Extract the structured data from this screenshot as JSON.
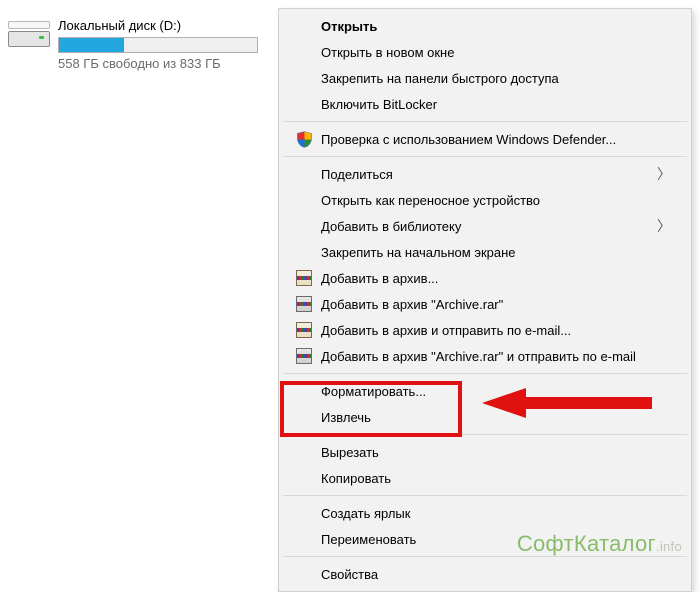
{
  "drive": {
    "name": "Локальный диск (D:)",
    "capacity_label": "558 ГБ свободно из 833 ГБ",
    "fill_percent": 33
  },
  "menu": {
    "items": [
      {
        "label": "Открыть",
        "bold": true
      },
      {
        "label": "Открыть в новом окне"
      },
      {
        "label": "Закрепить на панели быстрого доступа"
      },
      {
        "label": "Включить BitLocker"
      },
      {
        "sep": true
      },
      {
        "label": "Проверка с использованием Windows Defender...",
        "icon": "shield"
      },
      {
        "sep": true
      },
      {
        "label": "Поделиться",
        "submenu": true
      },
      {
        "label": "Открыть как переносное устройство"
      },
      {
        "label": "Добавить в библиотеку",
        "submenu": true
      },
      {
        "label": "Закрепить на начальном экране"
      },
      {
        "label": "Добавить в архив...",
        "icon": "rar"
      },
      {
        "label": "Добавить в архив \"Archive.rar\"",
        "icon": "rar2"
      },
      {
        "label": "Добавить в архив и отправить по e-mail...",
        "icon": "rar"
      },
      {
        "label": "Добавить в архив \"Archive.rar\" и отправить по e-mail",
        "icon": "rar2"
      },
      {
        "sep": true
      },
      {
        "label": "Форматировать...",
        "highlight": true
      },
      {
        "label": "Извлечь"
      },
      {
        "sep": true
      },
      {
        "label": "Вырезать"
      },
      {
        "label": "Копировать"
      },
      {
        "sep": true
      },
      {
        "label": "Создать ярлык"
      },
      {
        "label": "Переименовать"
      },
      {
        "sep": true
      },
      {
        "label": "Свойства"
      }
    ]
  },
  "watermark": {
    "brand": "СофтКаталог",
    "suffix": ".info"
  }
}
